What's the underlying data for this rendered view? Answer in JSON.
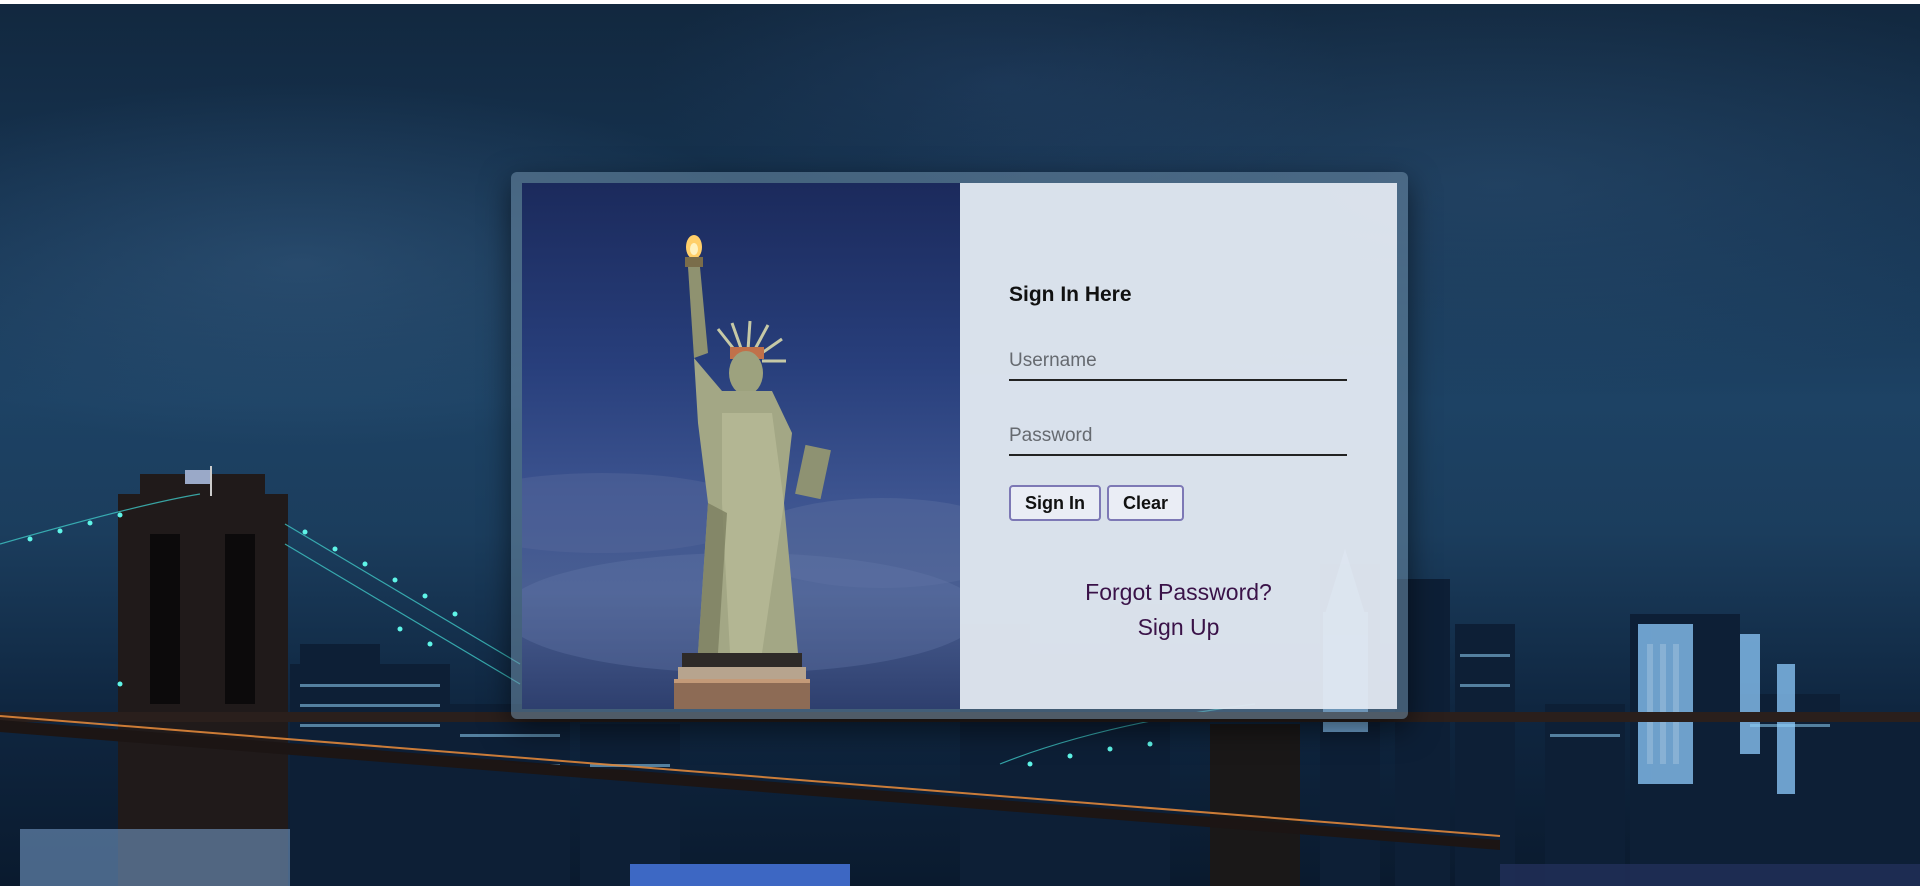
{
  "login": {
    "title": "Sign In Here",
    "username_placeholder": "Username",
    "password_placeholder": "Password",
    "sign_in_label": "Sign In",
    "clear_label": "Clear",
    "forgot_password_label": "Forgot Password?",
    "sign_up_label": "Sign Up"
  },
  "colors": {
    "link": "#3a1248",
    "button_border": "#7d78b5",
    "sky": "#163452"
  }
}
